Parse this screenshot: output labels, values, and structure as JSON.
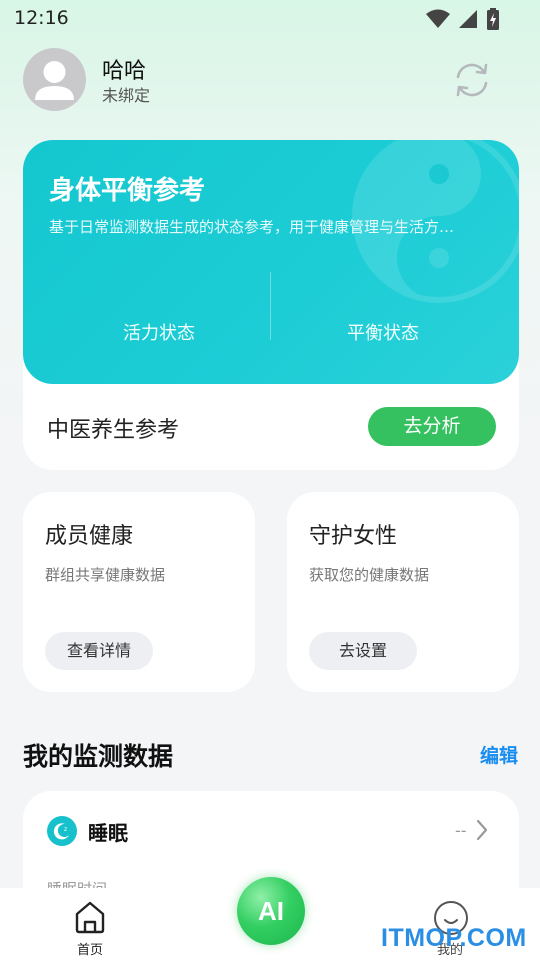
{
  "status_bar": {
    "time": "12:16"
  },
  "profile": {
    "name": "哈哈",
    "status": "未绑定"
  },
  "balance_card": {
    "title": "身体平衡参考",
    "description": "基于日常监测数据生成的状态参考，用于健康管理与生活方…",
    "left_stat": "活力状态",
    "right_stat": "平衡状态",
    "tcm_label": "中医养生参考",
    "analyze_label": "去分析"
  },
  "features": [
    {
      "title": "成员健康",
      "subtitle": "群组共享健康数据",
      "button": "查看详情"
    },
    {
      "title": "守护女性",
      "subtitle": "获取您的健康数据",
      "button": "去设置"
    }
  ],
  "monitoring": {
    "title": "我的监测数据",
    "edit_label": "编辑",
    "sleep": {
      "title": "睡眠",
      "value": "--",
      "subtitle": "睡眠时间"
    }
  },
  "bottom_nav": {
    "home_label": "首页",
    "ai_label": "AI",
    "me_label": "我的"
  },
  "watermark": "ITMOP.COM",
  "colors": {
    "teal": "#14c7cf",
    "green": "#35c15f",
    "blue": "#1a8ef0"
  }
}
